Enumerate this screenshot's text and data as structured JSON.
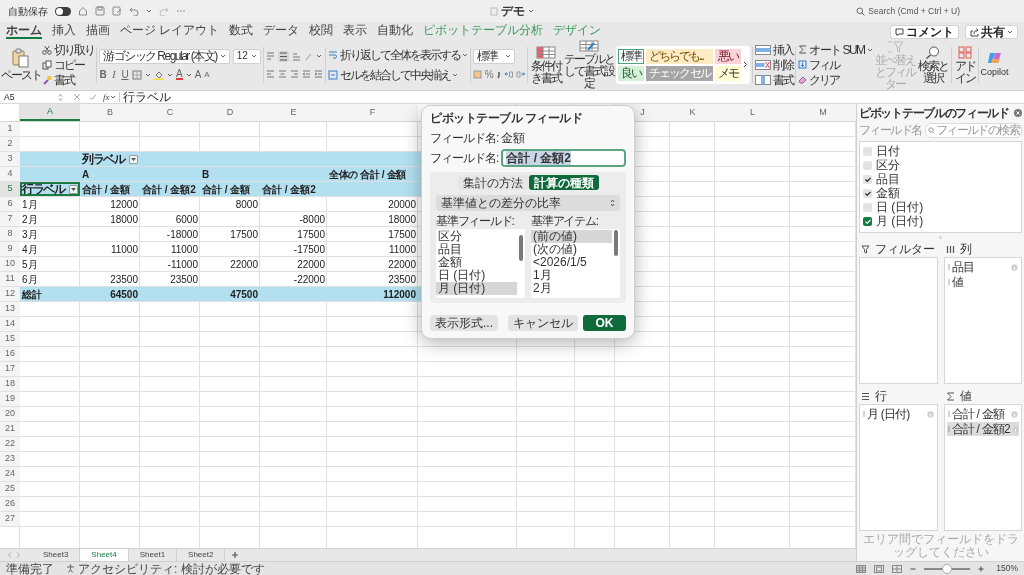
{
  "title_bar": {
    "autosave_label": "自動保存",
    "autosave_on": false,
    "document_title": "デモ",
    "search_placeholder": "Search (Cmd + Ctrl + U)"
  },
  "ribbon_tabs": [
    {
      "label": "ホーム",
      "selected": true,
      "kind": "standard"
    },
    {
      "label": "挿入",
      "selected": false,
      "kind": "standard"
    },
    {
      "label": "描画",
      "selected": false,
      "kind": "standard"
    },
    {
      "label": "ページ レイアウト",
      "selected": false,
      "kind": "standard"
    },
    {
      "label": "数式",
      "selected": false,
      "kind": "standard"
    },
    {
      "label": "データ",
      "selected": false,
      "kind": "standard"
    },
    {
      "label": "校閲",
      "selected": false,
      "kind": "standard"
    },
    {
      "label": "表示",
      "selected": false,
      "kind": "standard"
    },
    {
      "label": "自動化",
      "selected": false,
      "kind": "standard"
    },
    {
      "label": "ピボットテーブル分析",
      "selected": false,
      "kind": "contextual"
    },
    {
      "label": "デザイン",
      "selected": false,
      "kind": "contextual"
    }
  ],
  "header_buttons": {
    "comment": "コメント",
    "share": "共有"
  },
  "ribbon": {
    "clipboard": {
      "paste": "ペースト",
      "cut": "切り取り",
      "copy": "コピー",
      "format_painter": "書式"
    },
    "font": {
      "name": "游ゴシック Regular (本文)",
      "size": "12",
      "grow": "A",
      "shrink": "A",
      "bold": "B",
      "italic": "I",
      "underline": "U",
      "font_color": "A"
    },
    "alignment": {
      "wrap_text": "折り返して全体を表示する",
      "merge_center": "セルを結合して中央揃え"
    },
    "number": {
      "format": "標準",
      "percent": "%"
    },
    "styles": {
      "conditional_formatting": "条件付き書式",
      "format_as_table": "テーブルとして書式設定"
    },
    "cell_styles": [
      {
        "label": "標準",
        "color": "#ffffff",
        "selected": true
      },
      {
        "label": "どちらでも...",
        "color": "#fdebc6",
        "selected": false
      },
      {
        "label": "悪い",
        "color": "#fbd3d9",
        "selected": false
      },
      {
        "label": "良い",
        "color": "#d5efd9",
        "selected": false
      },
      {
        "label": "チェック セル",
        "color": "#a5a5a5",
        "selected": false
      },
      {
        "label": "メモ",
        "color": "#fffcd4",
        "selected": false
      }
    ],
    "cells": [
      "挿入",
      "削除",
      "書式"
    ],
    "editing": {
      "autosum": "オート SUM",
      "fill": "フィル",
      "clear": "クリア",
      "sort_filter": "並べ替えとフィルター",
      "sort_filter_disabled": true,
      "find_select": "検索と選択"
    },
    "add_ins": "アドイン",
    "copilot": "Copilot"
  },
  "formula_bar": {
    "cell_reference": "A5",
    "fx": "fx",
    "content": "行ラベル"
  },
  "grid": {
    "column_headers": [
      {
        "label": "A",
        "selected": true
      },
      {
        "label": "B",
        "selected": false
      },
      {
        "label": "C",
        "selected": false
      },
      {
        "label": "D",
        "selected": false
      },
      {
        "label": "E",
        "selected": false
      },
      {
        "label": "F",
        "selected": false
      },
      {
        "label": "J",
        "selected": false
      },
      {
        "label": "K",
        "selected": false
      },
      {
        "label": "L",
        "selected": false
      },
      {
        "label": "M",
        "selected": false
      }
    ],
    "row_headers": [
      {
        "label": "1",
        "selected": false
      },
      {
        "label": "2",
        "selected": false
      },
      {
        "label": "3",
        "selected": false
      },
      {
        "label": "4",
        "selected": false
      },
      {
        "label": "5",
        "selected": true
      },
      {
        "label": "6",
        "selected": false
      },
      {
        "label": "7",
        "selected": false
      },
      {
        "label": "8",
        "selected": false
      },
      {
        "label": "9",
        "selected": false
      },
      {
        "label": "10",
        "selected": false
      },
      {
        "label": "11",
        "selected": false
      },
      {
        "label": "12",
        "selected": false
      },
      {
        "label": "13",
        "selected": false
      },
      {
        "label": "14",
        "selected": false
      },
      {
        "label": "15",
        "selected": false
      },
      {
        "label": "16",
        "selected": false
      },
      {
        "label": "17",
        "selected": false
      },
      {
        "label": "18",
        "selected": false
      },
      {
        "label": "19",
        "selected": false
      },
      {
        "label": "20",
        "selected": false
      },
      {
        "label": "21",
        "selected": false
      },
      {
        "label": "22",
        "selected": false
      },
      {
        "label": "23",
        "selected": false
      },
      {
        "label": "24",
        "selected": false
      },
      {
        "label": "25",
        "selected": false
      },
      {
        "label": "26",
        "selected": false
      },
      {
        "label": "27",
        "selected": false
      }
    ]
  },
  "pivot": {
    "column_label_heading": "列ラベル",
    "row_label_heading": "行ラベル",
    "groups": [
      {
        "name": "A"
      },
      {
        "name": "B"
      }
    ],
    "grand_total_heading": "全体の 合計 / 金額",
    "value_headings": [
      "合計 / 金額",
      "合計 / 金額2",
      "合計 / 金額",
      "合計 / 金額2"
    ],
    "rows": [
      {
        "label": "1月",
        "a_sum": "12000",
        "b_sum": "8000",
        "total": "20000"
      },
      {
        "label": "2月",
        "a_sum": "18000",
        "a_sum2": "6000",
        "b_sum2": "-8000",
        "total": "18000"
      },
      {
        "label": "3月",
        "a_sum2": "-18000",
        "b_sum": "17500",
        "b_sum2": "17500",
        "total": "17500"
      },
      {
        "label": "4月",
        "a_sum": "11000",
        "a_sum2": "11000",
        "b_sum2": "-17500",
        "total": "11000"
      },
      {
        "label": "5月",
        "a_sum2": "-11000",
        "b_sum": "22000",
        "b_sum2": "22000",
        "total": "22000"
      },
      {
        "label": "6月",
        "a_sum": "23500",
        "a_sum2": "23500",
        "b_sum2": "-22000",
        "total": "23500"
      }
    ],
    "grand_total": {
      "label": "総計",
      "a_sum": "64500",
      "b_sum": "47500",
      "total": "112000"
    }
  },
  "field_settings_dialog": {
    "title": "ピボットテーブル フィールド",
    "source_label": "フィールド名:",
    "source_value": "金額",
    "name_label": "フィールド名:",
    "name_value": "合計 / 金額2",
    "tabs": [
      {
        "label": "集計の方法",
        "selected": false
      },
      {
        "label": "計算の種類",
        "selected": true
      }
    ],
    "calculation": "基準値との差分の比率",
    "base_field_label": "基準フィールド:",
    "base_item_label": "基準アイテム:",
    "base_fields": [
      {
        "label": "区分",
        "selected": false
      },
      {
        "label": "品目",
        "selected": false
      },
      {
        "label": "金額",
        "selected": false
      },
      {
        "label": "日 (日付)",
        "selected": false
      },
      {
        "label": "月 (日付)",
        "selected": true
      }
    ],
    "base_items": [
      {
        "label": "(前の値)",
        "selected": true
      },
      {
        "label": "(次の値)",
        "selected": false
      },
      {
        "label": "<2026/1/5",
        "selected": false
      },
      {
        "label": "1月",
        "selected": false
      },
      {
        "label": "2月",
        "selected": false
      }
    ],
    "buttons": [
      {
        "label": "表示形式...",
        "kind": "secondary"
      },
      {
        "label": "キャンセル",
        "kind": "secondary"
      },
      {
        "label": "OK",
        "kind": "primary"
      }
    ]
  },
  "fields_pane": {
    "title": "ピボットテーブルのフィールド",
    "field_name_label": "フィールド名",
    "search_placeholder": "フィールドの検索",
    "fields": [
      {
        "label": "日付",
        "checked": false,
        "selected": false
      },
      {
        "label": "区分",
        "checked": false,
        "selected": false
      },
      {
        "label": "品目",
        "checked": true,
        "selected": false
      },
      {
        "label": "金額",
        "checked": true,
        "selected": false
      },
      {
        "label": "日 (日付)",
        "checked": false,
        "selected": false
      },
      {
        "label": "月 (日付)",
        "checked": true,
        "selected": true
      }
    ],
    "areas": [
      {
        "kind": "filter",
        "label": "フィルター"
      },
      {
        "kind": "columns",
        "label": "列",
        "items": [
          {
            "label": "品目",
            "info": true,
            "selected": false
          },
          {
            "label": "値",
            "info": false,
            "selected": false
          }
        ]
      },
      {
        "kind": "rows",
        "label": "行",
        "items": [
          {
            "label": "月 (日付)",
            "info": true,
            "selected": false
          }
        ]
      },
      {
        "kind": "values",
        "label": "値",
        "items": [
          {
            "label": "合計 / 金額",
            "info": true,
            "selected": false
          },
          {
            "label": "合計 / 金額2",
            "info": true,
            "selected": true
          }
        ]
      }
    ],
    "hint": "エリア間でフィールドをドラッグしてください"
  },
  "sheet_tabs": [
    {
      "label": "Sheet3",
      "selected": false
    },
    {
      "label": "Sheet4",
      "selected": true
    },
    {
      "label": "Sheet1",
      "selected": false
    },
    {
      "label": "Sheet2",
      "selected": false
    }
  ],
  "status_bar": {
    "ready": "準備完了",
    "accessibility": "アクセシビリティ: 検討が必要です",
    "zoom_slider": {
      "level": 0.5
    },
    "zoom_percent": "150%"
  }
}
